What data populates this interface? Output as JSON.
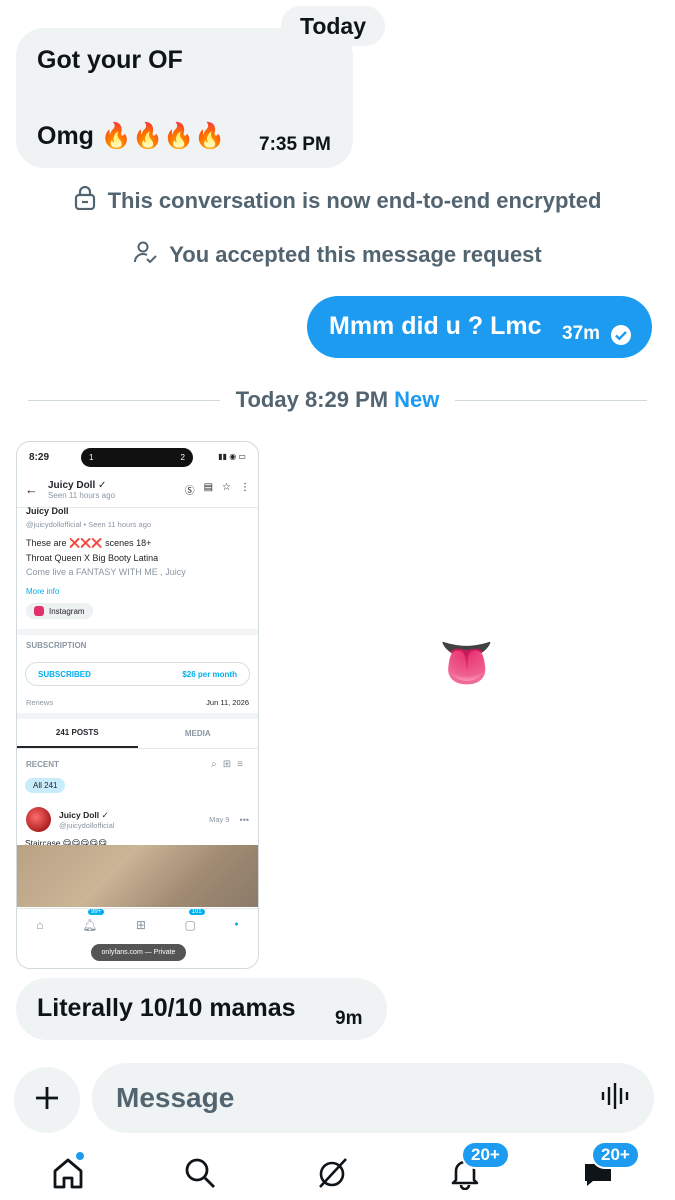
{
  "thread": {
    "day_label": "Today",
    "incoming_1": {
      "line1": "Got your OF",
      "line2": "Omg 🔥🔥🔥🔥",
      "time": "7:35 PM"
    },
    "encrypted_notice": "This conversation is now end-to-end encrypted",
    "accepted_notice": "You accepted this message request",
    "outgoing_1": {
      "text": "Mmm did u ? Lmc",
      "time": "37m"
    },
    "divider": {
      "label": "Today 8:29 PM",
      "new_label": "New"
    },
    "reaction_emoji": "👅",
    "incoming_2": {
      "text": "Literally 10/10 mamas",
      "time": "9m"
    }
  },
  "attachment": {
    "status_time": "8:29",
    "island_left": "1",
    "island_right": "2",
    "profile_name": "Juicy Doll",
    "seen": "Seen  11 hours ago",
    "cut_name": "Juicy Doll",
    "handle_line": "@juicydollofficial  •  Seen  11 hours ago",
    "bio_1": "These are ❌❌❌ scenes 18+",
    "bio_2": "Throat Queen X Big Booty Latina",
    "bio_3": "Come live a FANTASY WITH ME , Juicy",
    "more_info": "More info",
    "instagram": "Instagram",
    "subscription_header": "SUBSCRIPTION",
    "subscribed": "SUBSCRIBED",
    "price": "$26 per month",
    "renews_label": "Renews",
    "renews_date": "Jun 11, 2026",
    "tab_posts": "241 POSTS",
    "tab_media": "MEDIA",
    "recent": "RECENT",
    "all_chip": "All 241",
    "post_author": "Juicy Doll",
    "post_handle": "@juicydollofficial",
    "post_date": "May 9",
    "post_text": "Staircase 😋😋😋😋😋",
    "nav_badge_1": "99+",
    "nav_badge_2": "101",
    "url": "onlyfans.com — Private"
  },
  "composer": {
    "placeholder": "Message"
  },
  "tabbar": {
    "notifications_badge": "20+",
    "messages_badge": "20+"
  },
  "colors": {
    "accent": "#1d9bf0",
    "bubble_in": "#eff3f4",
    "muted": "#536471"
  }
}
